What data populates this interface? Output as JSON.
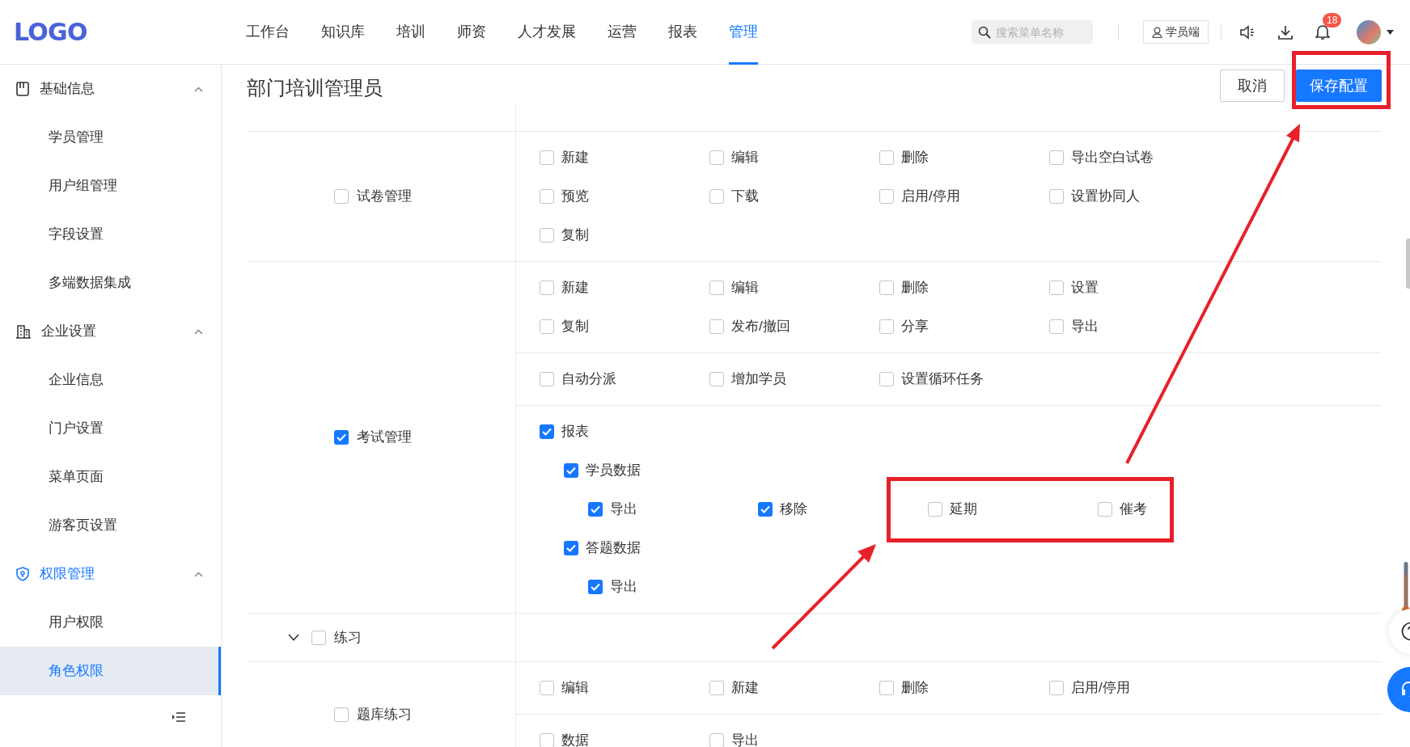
{
  "logo": "LOGO",
  "nav": [
    {
      "label": "工作台",
      "selected": false
    },
    {
      "label": "知识库",
      "selected": false
    },
    {
      "label": "培训",
      "selected": false
    },
    {
      "label": "师资",
      "selected": false
    },
    {
      "label": "人才发展",
      "selected": false
    },
    {
      "label": "运营",
      "selected": false
    },
    {
      "label": "报表",
      "selected": false
    },
    {
      "label": "管理",
      "selected": true
    }
  ],
  "search": {
    "placeholder": "搜索菜单名称"
  },
  "student_button": "学员端",
  "notifications": {
    "count": "18"
  },
  "sidebar": {
    "groups": [
      {
        "label": "基础信息",
        "expanded": true,
        "items": [
          {
            "label": "学员管理",
            "selected": false
          },
          {
            "label": "用户组管理",
            "selected": false
          },
          {
            "label": "字段设置",
            "selected": false
          },
          {
            "label": "多端数据集成",
            "selected": false
          }
        ]
      },
      {
        "label": "企业设置",
        "expanded": true,
        "items": [
          {
            "label": "企业信息",
            "selected": false
          },
          {
            "label": "门户设置",
            "selected": false
          },
          {
            "label": "菜单页面",
            "selected": false
          },
          {
            "label": "游客页设置",
            "selected": false
          }
        ]
      },
      {
        "label": "权限管理",
        "expanded": true,
        "items": [
          {
            "label": "用户权限",
            "selected": false
          },
          {
            "label": "角色权限",
            "selected": true
          }
        ]
      }
    ]
  },
  "page": {
    "title": "部门培训管理员",
    "buttons": [
      {
        "label": "取消",
        "kind": "secondary"
      },
      {
        "label": "保存配置",
        "kind": "primary"
      }
    ]
  },
  "permissions": [
    {
      "label": "试卷管理",
      "checked": false,
      "sections": [
        {
          "items": [
            {
              "label": "新建",
              "checked": false
            },
            {
              "label": "编辑",
              "checked": false
            },
            {
              "label": "删除",
              "checked": false
            },
            {
              "label": "导出空白试卷",
              "checked": false
            },
            {
              "label": "预览",
              "checked": false
            },
            {
              "label": "下载",
              "checked": false
            },
            {
              "label": "启用/停用",
              "checked": false
            },
            {
              "label": "设置协同人",
              "checked": false
            },
            {
              "label": "复制",
              "checked": false
            }
          ]
        }
      ]
    },
    {
      "label": "考试管理",
      "checked": true,
      "sections": [
        {
          "items": [
            {
              "label": "新建",
              "checked": false
            },
            {
              "label": "编辑",
              "checked": false
            },
            {
              "label": "删除",
              "checked": false
            },
            {
              "label": "设置",
              "checked": false
            },
            {
              "label": "复制",
              "checked": false
            },
            {
              "label": "发布/撤回",
              "checked": false
            },
            {
              "label": "分享",
              "checked": false
            },
            {
              "label": "导出",
              "checked": false
            }
          ]
        },
        {
          "items": [
            {
              "label": "自动分派",
              "checked": false
            },
            {
              "label": "增加学员",
              "checked": false
            },
            {
              "label": "设置循环任务",
              "checked": false
            }
          ]
        },
        {
          "items": [
            {
              "label": "报表",
              "checked": true,
              "children": [
                {
                  "label": "学员数据",
                  "checked": true,
                  "children": [
                    {
                      "label": "导出",
                      "checked": true
                    },
                    {
                      "label": "移除",
                      "checked": true
                    },
                    {
                      "label": "延期",
                      "checked": false
                    },
                    {
                      "label": "催考",
                      "checked": false
                    }
                  ]
                },
                {
                  "label": "答题数据",
                  "checked": true,
                  "children": [
                    {
                      "label": "导出",
                      "checked": true
                    }
                  ]
                }
              ]
            }
          ]
        }
      ]
    },
    {
      "label": "练习",
      "checked": false,
      "expanded": true
    },
    {
      "label": "题库练习",
      "checked": false,
      "sections": [
        {
          "items": [
            {
              "label": "编辑",
              "checked": false
            },
            {
              "label": "新建",
              "checked": false
            },
            {
              "label": "删除",
              "checked": false
            },
            {
              "label": "启用/停用",
              "checked": false
            }
          ]
        },
        {
          "items": [
            {
              "label": "数据",
              "checked": false
            },
            {
              "label": "导出",
              "checked": false
            }
          ]
        }
      ]
    }
  ]
}
